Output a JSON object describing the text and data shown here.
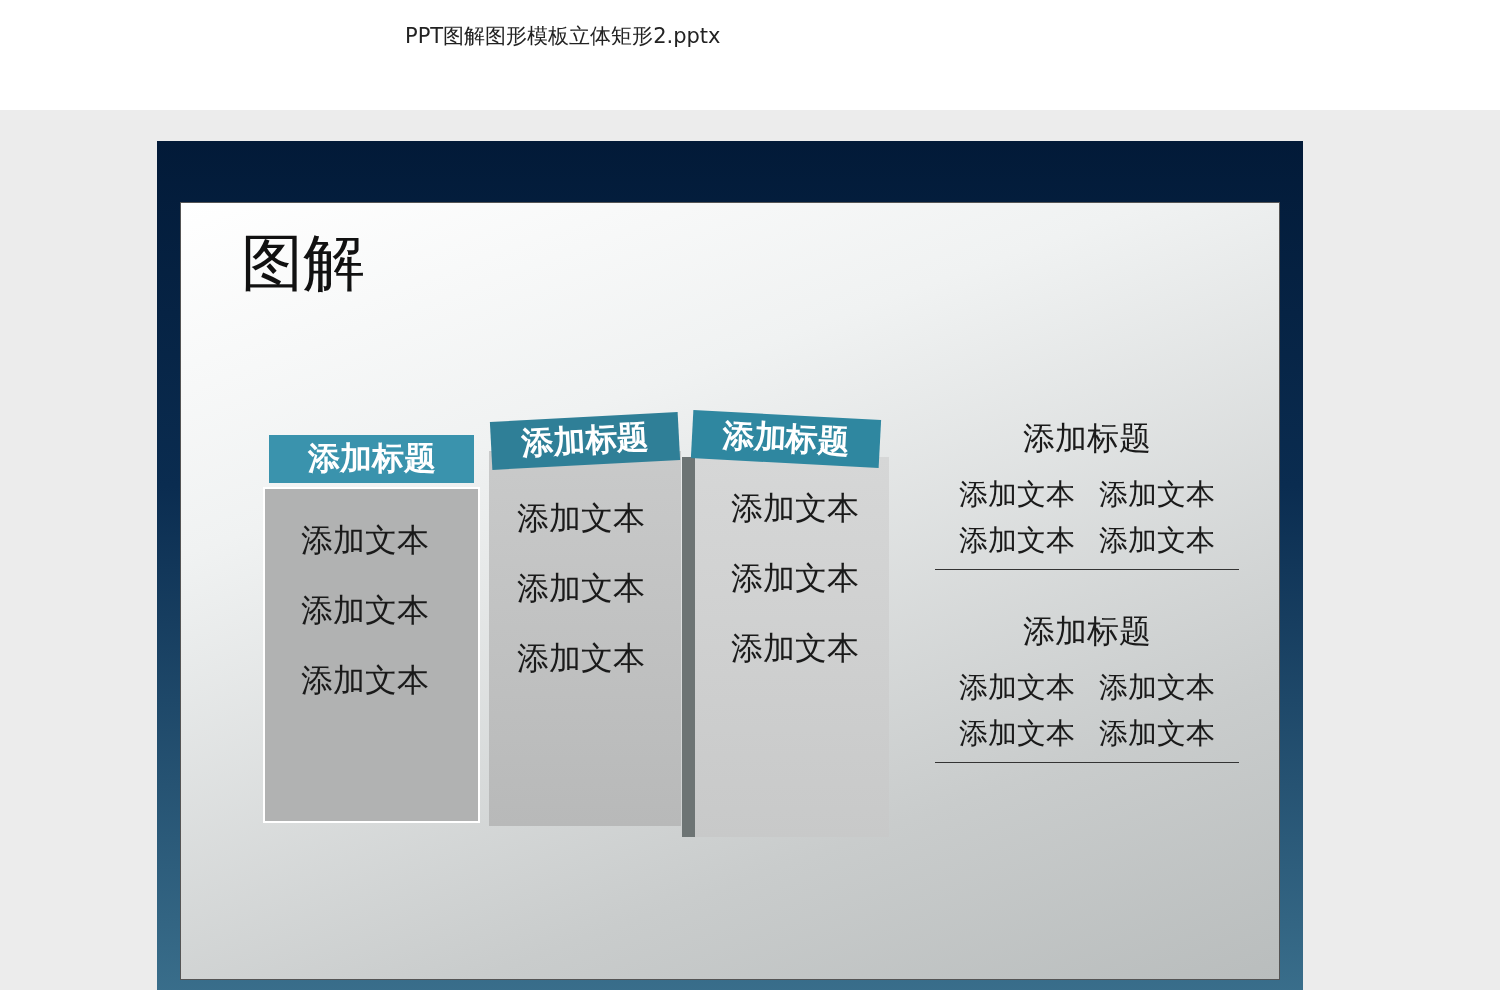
{
  "file": {
    "title": "PPT图解图形模板立体矩形2.pptx"
  },
  "slide": {
    "title": "图解",
    "columns": [
      {
        "title": "添加标题",
        "items": [
          "添加文本",
          "添加文本",
          "添加文本"
        ]
      },
      {
        "title": "添加标题",
        "items": [
          "添加文本",
          "添加文本",
          "添加文本"
        ]
      },
      {
        "title": "添加标题",
        "items": [
          "添加文本",
          "添加文本",
          "添加文本"
        ]
      }
    ],
    "sections": [
      {
        "title": "添加标题",
        "items": [
          "添加文本",
          "添加文本",
          "添加文本",
          "添加文本"
        ]
      },
      {
        "title": "添加标题",
        "items": [
          "添加文本",
          "添加文本",
          "添加文本",
          "添加文本"
        ]
      }
    ]
  }
}
